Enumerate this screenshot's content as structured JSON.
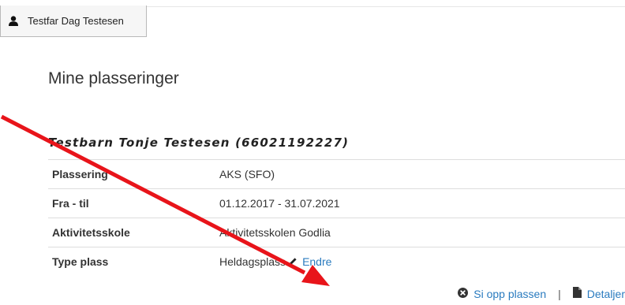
{
  "header": {
    "user_name": "Testfar Dag Testesen",
    "user_icon": "user-icon"
  },
  "main": {
    "title": "Mine plasseringer",
    "child_heading": "Testbarn Tonje Testesen (66021192227)",
    "rows": [
      {
        "label": "Plassering",
        "value": "AKS (SFO)"
      },
      {
        "label": "Fra - til",
        "value": "01.12.2017 - 31.07.2021"
      },
      {
        "label": "Aktivitetsskole",
        "value": "Aktivitetsskolen Godlia"
      },
      {
        "label": "Type plass",
        "value": "Heldagsplass"
      }
    ],
    "edit_label": "Endre",
    "edit_icon": "pencil-icon"
  },
  "actions": {
    "cancel_label": "Si opp plassen",
    "cancel_icon": "times-circle-icon",
    "separator": "|",
    "details_label": "Detaljer",
    "details_icon": "document-icon"
  },
  "colors": {
    "link": "#2a7bbf",
    "annotation_arrow": "#e8141a"
  }
}
